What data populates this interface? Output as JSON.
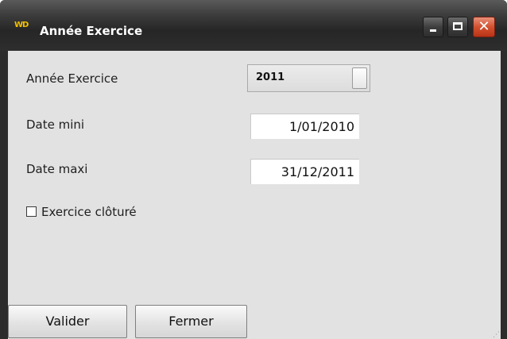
{
  "window": {
    "title": "Année Exercice",
    "app_icon_text": "WD",
    "controls": {
      "minimize": "minimize",
      "maximize": "maximize",
      "close": "✕"
    }
  },
  "form": {
    "year_label": "Année Exercice",
    "year_value": "2011",
    "date_min_label": "Date  mini",
    "date_min_value": "1/01/2010",
    "date_max_label": "Date maxi",
    "date_max_value": "31/12/2011",
    "closed_label": "Exercice clôturé",
    "closed_checked": false
  },
  "buttons": {
    "validate": "Valider",
    "close": "Fermer"
  },
  "colors": {
    "close_button": "#d1512f",
    "app_icon": "#f4c000"
  }
}
